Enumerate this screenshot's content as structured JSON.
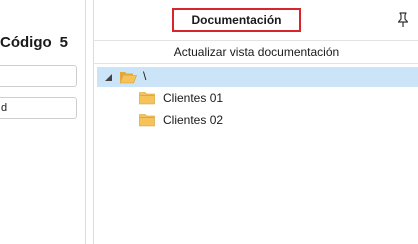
{
  "left_panel": {
    "title": "Código",
    "count": "5",
    "inputs": [
      {
        "value": ""
      },
      {
        "value": "d"
      }
    ]
  },
  "header": {
    "title": "Documentación",
    "title_border_color": "#d7262b",
    "pin_icon": "pin-icon"
  },
  "refresh_label": "Actualizar vista documentación",
  "tree": {
    "root": {
      "label": "\\",
      "icon": "folder-open-icon",
      "selected": true,
      "expanded": true
    },
    "children": [
      {
        "label": "Clientes 01",
        "icon": "folder-icon"
      },
      {
        "label": "Clientes 02",
        "icon": "folder-icon"
      }
    ],
    "selection_color": "#cce4f7",
    "folder_color": "#f5c35a"
  }
}
